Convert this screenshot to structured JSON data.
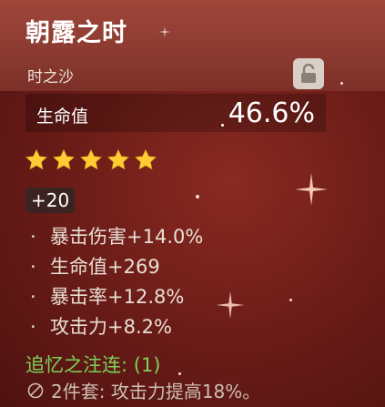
{
  "artifact": {
    "name": "朝露之时",
    "slot": "时之沙",
    "main_stat": {
      "name": "生命值",
      "value": "46.6%"
    },
    "rarity_stars": 5,
    "level": "+20",
    "substats": [
      {
        "text": "暴击伤害+14.0%"
      },
      {
        "text": "生命值+269"
      },
      {
        "text": "暴击率+12.8%"
      },
      {
        "text": "攻击力+8.2%"
      }
    ],
    "set": {
      "name": "追忆之注连: (1)",
      "effect": "2件套: 攻击力提高18%。"
    }
  },
  "icons": {
    "lock": "lock-icon",
    "star": "star-icon",
    "set_effect": "prohibited-circle-icon"
  },
  "colors": {
    "header_bg": "#8a3a30",
    "body_bg": "#6e1d18",
    "star": "#ffcc33",
    "set_name": "#7cd25a"
  }
}
